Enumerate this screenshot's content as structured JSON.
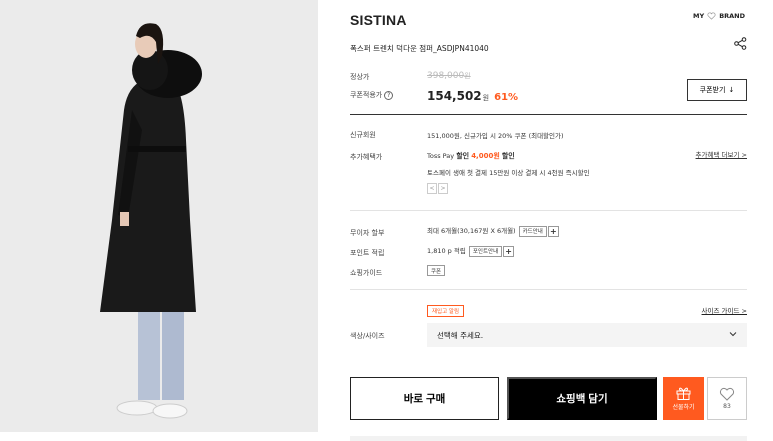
{
  "product": {
    "brand": "SISTINA",
    "name": "폭스퍼 트렌치 덕다운 점퍼_ASDJPN41040",
    "image_alt": "model wearing black long down coat"
  },
  "header": {
    "my_brand": "MY",
    "brand_label": "BRAND",
    "share_icon": "share-icon"
  },
  "pricing": {
    "regular_label": "정상가",
    "regular_price": "398,000",
    "regular_unit": "원",
    "coupon_label": "쿠폰적용가",
    "help_mark": "?",
    "coupon_price": "154,502",
    "coupon_unit": "원",
    "discount": "61%",
    "coupon_button": "쿠폰받기",
    "download_icon": "↓"
  },
  "benefits": {
    "new_member_label": "신규회원",
    "new_member_text": "151,000원, 신규가입 시 20% 쿠폰 (최대할인가)",
    "extra_label": "추가혜택가",
    "extra_line1_prefix": "Toss Pay",
    "extra_line1_discount": "할인",
    "extra_line1_amount": "4,000원",
    "extra_line1_suffix": "할인",
    "extra_line2": "토스페이 생애 첫 결제 15만원 이상 결제 시 4천원 즉시할인",
    "more_link": "추가혜택 더보기 >",
    "prev": "<",
    "next": ">"
  },
  "payment": {
    "installment_label": "무이자 할부",
    "installment_text": "최대 6개월(30,167원 X 6개월)",
    "card_info": "카드안내",
    "points_label": "포인트 적립",
    "points_text": "1,810 p 적립",
    "points_info": "포인트안내",
    "guide_label": "쇼핑가이드",
    "guide_tag": "쿠폰",
    "plus": "+"
  },
  "options": {
    "restock": "재입고 알림",
    "size_guide": "사이즈 가이드 >",
    "color_size_label": "색상/사이즈",
    "select_placeholder": "선택해 주세요."
  },
  "actions": {
    "buy_now": "바로 구매",
    "add_cart": "쇼핑백 담기",
    "gift": "선물하기",
    "likes": "83"
  },
  "colors": {
    "accent": "#ff5a1f",
    "dark": "#000000"
  }
}
